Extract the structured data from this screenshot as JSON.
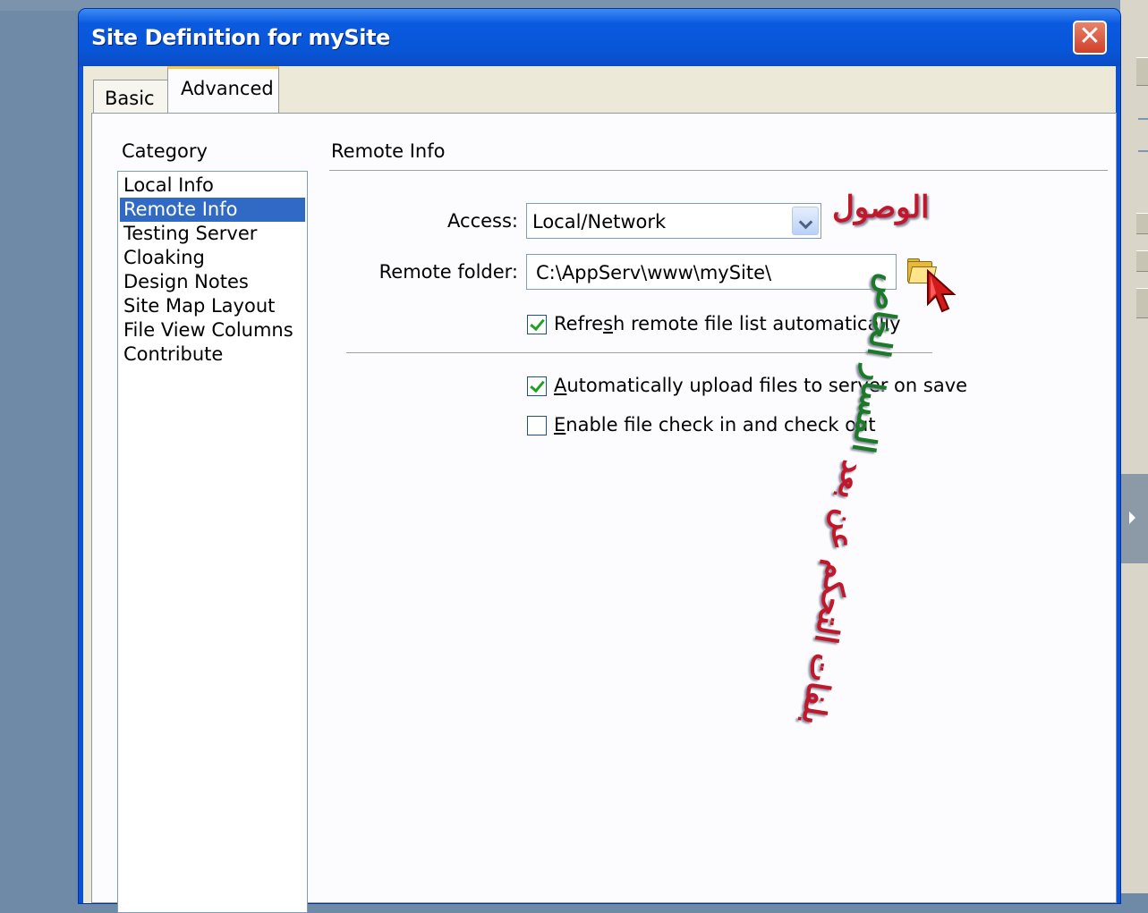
{
  "window": {
    "title": "Site Definition for mySite",
    "close_glyph": "✕"
  },
  "tabs": [
    {
      "label": "Basic",
      "selected": false
    },
    {
      "label": "Advanced",
      "selected": true
    }
  ],
  "category": {
    "label": "Category",
    "items": [
      {
        "label": "Local Info",
        "selected": false
      },
      {
        "label": "Remote Info",
        "selected": true
      },
      {
        "label": "Testing Server",
        "selected": false
      },
      {
        "label": "Cloaking",
        "selected": false
      },
      {
        "label": "Design Notes",
        "selected": false
      },
      {
        "label": "Site Map Layout",
        "selected": false
      },
      {
        "label": "File View Columns",
        "selected": false
      },
      {
        "label": "Contribute",
        "selected": false
      }
    ]
  },
  "remote_info": {
    "section_title": "Remote Info",
    "access_label": "Access:",
    "access_value": "Local/Network",
    "folder_label": "Remote folder:",
    "folder_value": "C:\\AppServ\\www\\mySite\\",
    "refresh": {
      "pre": "Refre",
      "accel": "s",
      "post": "h remote file list automatically",
      "checked": true
    },
    "auto_upload": {
      "pre": "",
      "accel": "A",
      "post": "utomatically upload files to server on save",
      "checked": true
    },
    "checkin": {
      "pre": "",
      "accel": "E",
      "post": "nable file check in and check out",
      "checked": false
    }
  },
  "annotations": {
    "access": "الوصول",
    "path_part1": "المسار الخاص",
    "path_part2": "بلفات التحكم عن بعد"
  },
  "colors": {
    "titlebar": "#0a52d8",
    "selection": "#316ac5",
    "annotation_red": "#c0182a",
    "annotation_green": "#1b7a28"
  }
}
